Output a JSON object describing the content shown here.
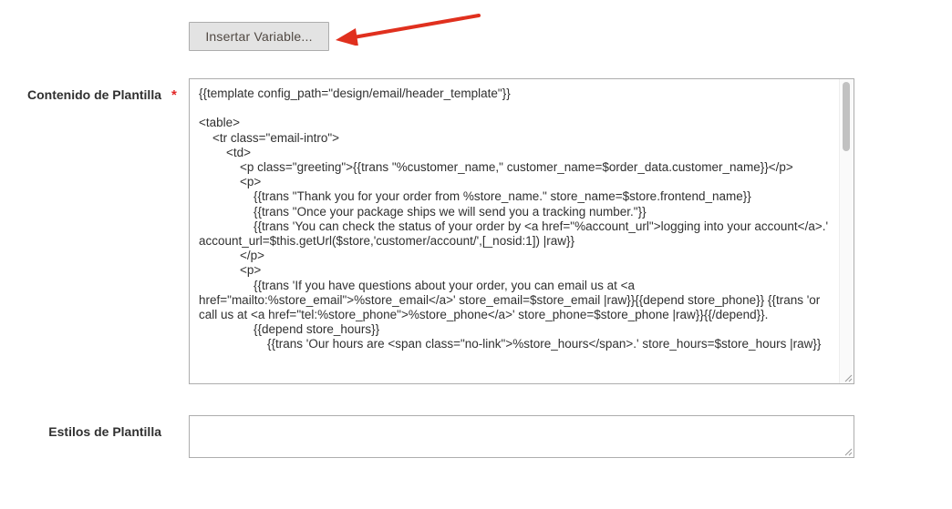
{
  "toolbar": {
    "insert_variable_label": "Insertar Variable..."
  },
  "fields": {
    "template_content": {
      "label": "Contenido de Plantilla",
      "required_mark": "*",
      "value": "{{template config_path=\"design/email/header_template\"}}\n\n<table>\n    <tr class=\"email-intro\">\n        <td>\n            <p class=\"greeting\">{{trans \"%customer_name,\" customer_name=$order_data.customer_name}}</p>\n            <p>\n                {{trans \"Thank you for your order from %store_name.\" store_name=$store.frontend_name}}\n                {{trans \"Once your package ships we will send you a tracking number.\"}}\n                {{trans 'You can check the status of your order by <a href=\"%account_url\">logging into your account</a>.' account_url=$this.getUrl($store,'customer/account/',[_nosid:1]) |raw}}\n            </p>\n            <p>\n                {{trans 'If you have questions about your order, you can email us at <a href=\"mailto:%store_email\">%store_email</a>' store_email=$store_email |raw}}{{depend store_phone}} {{trans 'or call us at <a href=\"tel:%store_phone\">%store_phone</a>' store_phone=$store_phone |raw}}{{/depend}}.\n                {{depend store_hours}}\n                    {{trans 'Our hours are <span class=\"no-link\">%store_hours</span>.' store_hours=$store_hours |raw}}"
    },
    "template_styles": {
      "label": "Estilos de Plantilla",
      "value": ""
    }
  },
  "colors": {
    "required": "#e22626",
    "annotation_arrow": "#e0301e",
    "button_bg": "#e3e3e3",
    "border": "#adadad"
  }
}
